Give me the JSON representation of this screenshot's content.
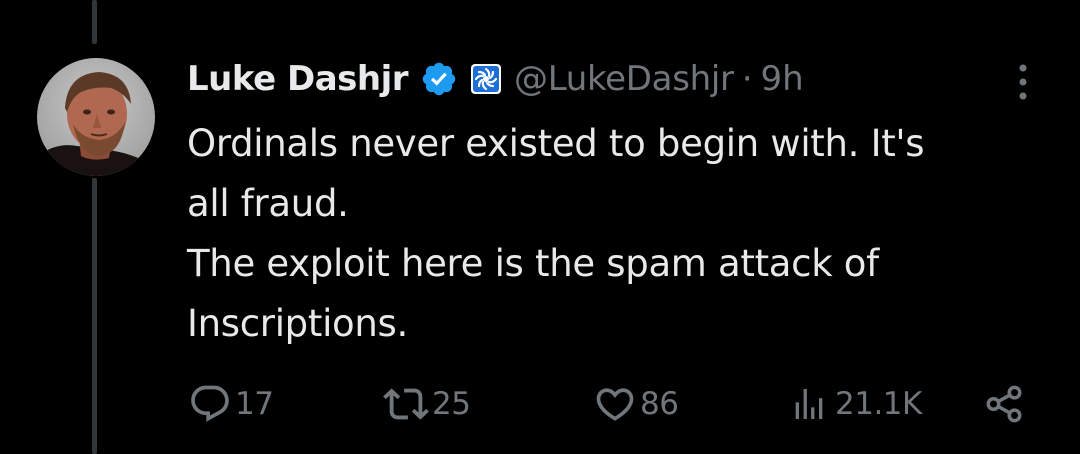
{
  "tweet": {
    "author": {
      "display_name": "Luke Dashjr",
      "handle": "@LukeDashjr",
      "verified_color": "#1d9bf0"
    },
    "separator": "·",
    "time": "9h",
    "text_lines": [
      "Ordinals never existed to begin with. It's",
      "all fraud.",
      "The exploit here is the spam attack of",
      "Inscriptions."
    ],
    "actions": {
      "replies": "17",
      "retweets": "25",
      "likes": "86",
      "views": "21.1K"
    }
  },
  "icons": {
    "verified": "verified-badge-icon",
    "affiliate": "affiliate-badge-icon",
    "more": "more-vertical-icon",
    "reply": "reply-icon",
    "retweet": "retweet-icon",
    "like": "heart-icon",
    "views": "analytics-icon",
    "share": "share-icon"
  },
  "colors": {
    "background": "#000000",
    "text": "#e7e9ea",
    "secondary": "#71767b",
    "thread_line": "#333639"
  }
}
